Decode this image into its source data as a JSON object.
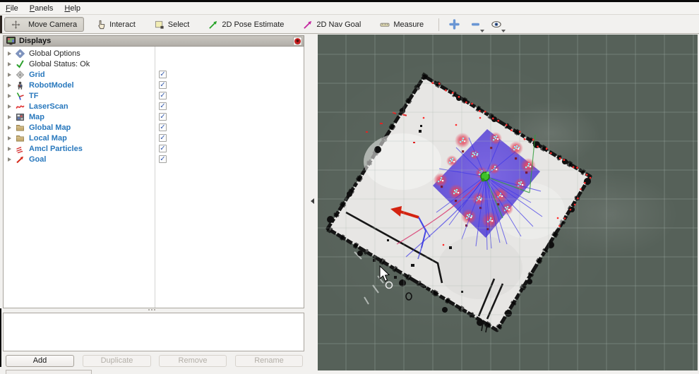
{
  "menubar": {
    "items": [
      {
        "label": "File"
      },
      {
        "label": "Panels"
      },
      {
        "label": "Help"
      }
    ]
  },
  "toolbar": {
    "tools": [
      {
        "label": "Move Camera",
        "icon": "move-camera-icon",
        "active": true
      },
      {
        "label": "Interact",
        "icon": "interact-hand-icon",
        "active": false
      },
      {
        "label": "Select",
        "icon": "select-box-icon",
        "active": false
      },
      {
        "label": "2D Pose Estimate",
        "icon": "pose-estimate-arrow-icon",
        "active": false,
        "arrow_color": "#29a329"
      },
      {
        "label": "2D Nav Goal",
        "icon": "nav-goal-arrow-icon",
        "active": false,
        "arrow_color": "#c428a0"
      },
      {
        "label": "Measure",
        "icon": "measure-icon",
        "active": false
      }
    ],
    "actions": [
      {
        "name": "add-tool",
        "icon": "plus-icon"
      },
      {
        "name": "remove-tool",
        "icon": "minus-icon",
        "has_menu": true
      },
      {
        "name": "tool-visibility",
        "icon": "eye-icon",
        "has_menu": true
      }
    ]
  },
  "displays_panel": {
    "title": "Displays",
    "check_glyph": "✓",
    "items": [
      {
        "label": "Global Options",
        "icon": "gear-icon",
        "checkbox": false,
        "checked": false
      },
      {
        "label": "Global Status: Ok",
        "icon": "status-ok-check-icon",
        "checkbox": false,
        "checked": false
      },
      {
        "label": "Grid",
        "icon": "grid-icon",
        "checkbox": true,
        "checked": true
      },
      {
        "label": "RobotModel",
        "icon": "robot-icon",
        "checkbox": true,
        "checked": true
      },
      {
        "label": "TF",
        "icon": "tf-axes-icon",
        "checkbox": true,
        "checked": true
      },
      {
        "label": "LaserScan",
        "icon": "laserscan-icon",
        "checkbox": true,
        "checked": true
      },
      {
        "label": "Map",
        "icon": "map-icon",
        "checkbox": true,
        "checked": true
      },
      {
        "label": "Global Map",
        "icon": "folder-icon",
        "checkbox": true,
        "checked": true
      },
      {
        "label": "Local Map",
        "icon": "folder-icon",
        "checkbox": true,
        "checked": true
      },
      {
        "label": "Amcl Particles",
        "icon": "particles-icon",
        "checkbox": true,
        "checked": true
      },
      {
        "label": "Goal",
        "icon": "goal-arrow-icon",
        "checkbox": true,
        "checked": true
      }
    ],
    "buttons": [
      {
        "label": "Add",
        "enabled": true
      },
      {
        "label": "Duplicate",
        "enabled": false
      },
      {
        "label": "Remove",
        "enabled": false
      },
      {
        "label": "Rename",
        "enabled": false
      }
    ]
  },
  "viewport": {
    "description": "rviz 3D view: occupancy grid map with AMCL particles, local costmap and robot",
    "colors": {
      "background": "#566159",
      "grid_line": "#aebbb4",
      "map_fill": "#e7e6e4",
      "map_border": "#141414",
      "costmap_base_inner": "#7761e2",
      "costmap_base_outer": "#5a49d2",
      "costmap_obstacle": "#e8485e",
      "costmap_cell": "#8df4ff",
      "lethal_cell": "#7c1222",
      "robot": "#3ec228",
      "laser_point": "#ff2a2a",
      "goal_arrow": "#d42310",
      "trajectory": "#3c35e8",
      "path_green": "#2f9e3a"
    }
  }
}
